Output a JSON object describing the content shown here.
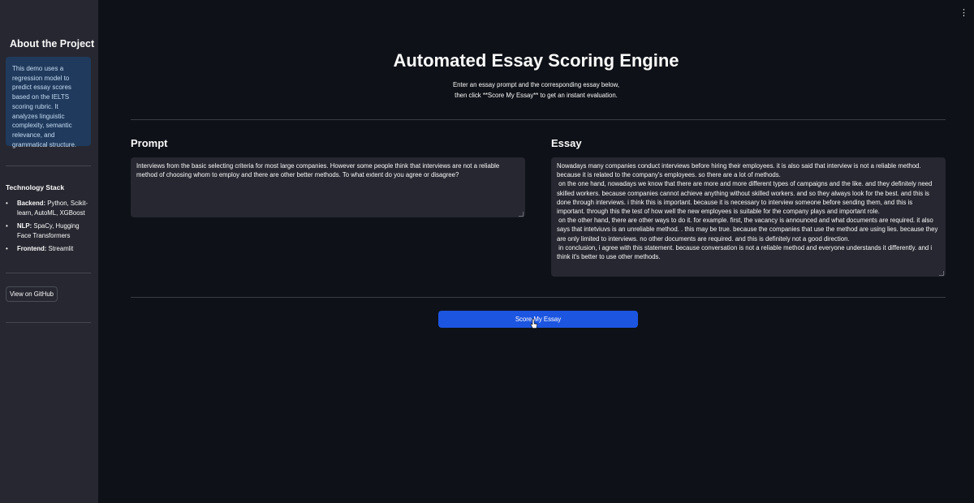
{
  "sidebar": {
    "title": "About the Project",
    "info_text": "This demo uses a regression model to predict essay scores based on the IELTS scoring rubric. It analyzes linguistic complexity, semantic relevance, and grammatical structure.",
    "stack_title": "Technology Stack",
    "stack_items": [
      {
        "label": "Backend:",
        "value": " Python, Scikit-learn, AutoML, XGBoost"
      },
      {
        "label": "NLP:",
        "value": " SpaCy, Hugging Face Transformers"
      },
      {
        "label": "Frontend:",
        "value": " Streamlit"
      }
    ],
    "github_label": "View on GitHub"
  },
  "header": {
    "menu_icon": "vertical-ellipsis-icon",
    "title": "Automated Essay Scoring Engine",
    "subtitle_line1": "Enter an essay prompt and the corresponding essay below,",
    "subtitle_line2": "then click **Score My Essay** to get an instant evaluation."
  },
  "prompt": {
    "label": "Prompt",
    "value": "Interviews from the basic selecting criteria for most large companies. However some people think that interviews are not a reliable method of choosing whom to employ and there are other better methods. To what extent do you agree or disagree?"
  },
  "essay": {
    "label": "Essay",
    "value": "Nowadays many companies conduct interviews before hiring their employees. it is also said that interview is not a reliable method. because it is related to the company's employees. so there are a lot of methods.\n on the one hand, nowadays we know that there are more and more different types of campaigns and the like. and they definitely need skilled workers. because companies cannot achieve anything without skilled workers. and so they always look for the best. and this is done through interviews. i think this is important. because it is necessary to interview someone before sending them, and this is important. through this the test of how well the new employees is suitable for the company plays and important role.\n on the other hand, there are other ways to do it. for example. first, the vacancy is announced and what documents are required. it also says that intetviuvs is an unreliable method. . this may be true. because the companies that use the method are using lies. because they are only limited to interviews. no other documents are required. and this is definitely not a good direction.\n in conclusion, i agree with this statement. because conversation is not a reliable method and everyone understands it differently. and i think it's better to use other methods."
  },
  "actions": {
    "score_label": "Score My Essay"
  },
  "colors": {
    "background": "#0e1117",
    "sidebar": "#262730",
    "info_box": "#1f3a5c",
    "primary_button": "#1c55e0"
  }
}
